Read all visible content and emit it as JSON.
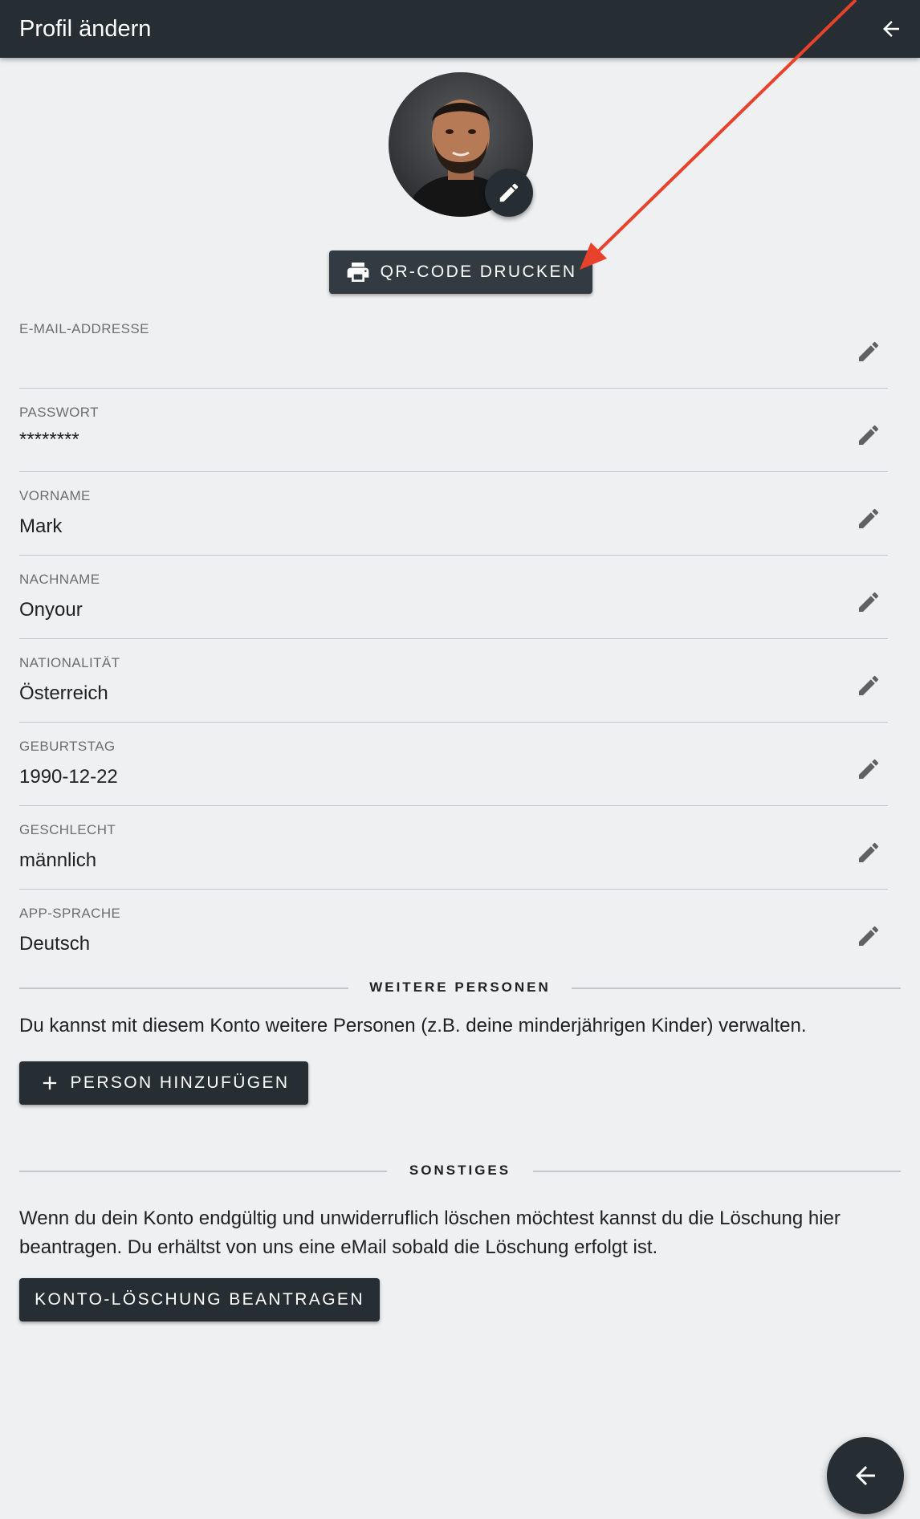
{
  "header": {
    "title": "Profil ändern"
  },
  "profile": {
    "qr_button_label": "QR-CODE DRUCKEN"
  },
  "fields": [
    {
      "label": "E-MAIL-ADDRESSE",
      "value": ""
    },
    {
      "label": "PASSWORT",
      "value": "********"
    },
    {
      "label": "VORNAME",
      "value": "Mark"
    },
    {
      "label": "NACHNAME",
      "value": "Onyour"
    },
    {
      "label": "NATIONALITÄT",
      "value": "Österreich"
    },
    {
      "label": "GEBURTSTAG",
      "value": "1990-12-22"
    },
    {
      "label": "GESCHLECHT",
      "value": "männlich"
    },
    {
      "label": "APP-SPRACHE",
      "value": "Deutsch"
    }
  ],
  "persons_section": {
    "title": "WEITERE PERSONEN",
    "description": "Du kannst mit diesem Konto weitere Personen (z.B. deine minderjährigen Kinder) verwalten.",
    "add_button_label": "PERSON HINZUFÜGEN"
  },
  "misc_section": {
    "title": "SONSTIGES",
    "description": "Wenn du dein Konto endgültig und unwiderruflich löschen möchtest kannst du die Löschung hier beantragen. Du erhältst von uns eine eMail sobald die Löschung erfolgt ist.",
    "delete_button_label": "KONTO-LÖSCHUNG BEANTRAGEN"
  },
  "icons": {
    "back": "arrow-back-icon",
    "edit": "pencil-icon",
    "print": "printer-icon",
    "add": "plus-icon"
  },
  "colors": {
    "appbar": "#262e33",
    "background": "#eff0f2",
    "annotation_arrow": "#e8412c"
  }
}
